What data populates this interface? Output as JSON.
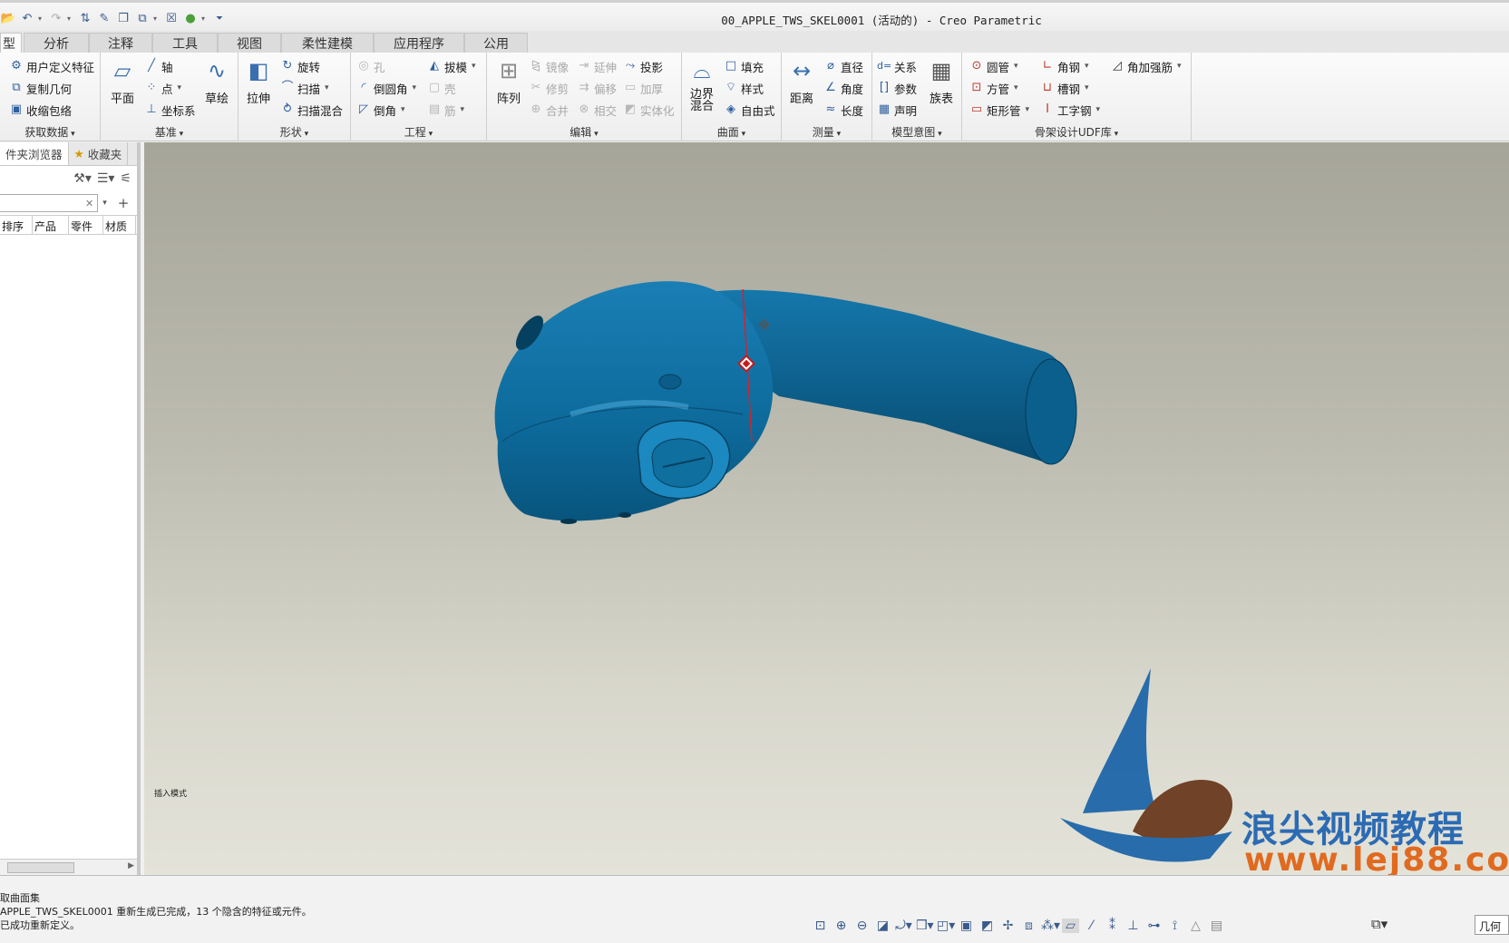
{
  "window": {
    "title": "00_APPLE_TWS_SKEL0001 (活动的) - Creo Parametric"
  },
  "tabs": [
    "型",
    "分析",
    "注释",
    "工具",
    "视图",
    "柔性建模",
    "应用程序",
    "公用"
  ],
  "ribbon": {
    "get_data": {
      "label": "获取数据",
      "items": [
        "用户定义特征",
        "复制几何",
        "收缩包络"
      ]
    },
    "datum": {
      "label": "基准",
      "plane": "平面",
      "axis": "轴",
      "point": "点",
      "csys": "坐标系",
      "sketch": "草绘"
    },
    "shapes": {
      "label": "形状",
      "extrude": "拉伸",
      "revolve": "旋转",
      "sweep": "扫描",
      "swept_blend": "扫描混合"
    },
    "engineering": {
      "label": "工程",
      "hole": "孔",
      "draft": "拔模",
      "round": "倒圆角",
      "shell": "壳",
      "chamfer": "倒角",
      "rib": "筋"
    },
    "editing": {
      "label": "编辑",
      "pattern": "阵列",
      "mirror": "镜像",
      "extend": "延伸",
      "project": "投影",
      "trim": "修剪",
      "offset": "偏移",
      "thicken": "加厚",
      "merge": "合并",
      "intersect": "相交",
      "solidify": "实体化"
    },
    "surfaces": {
      "label": "曲面",
      "boundary_blend_1": "边界",
      "boundary_blend_2": "混合",
      "fill": "填充",
      "style": "样式",
      "freestyle": "自由式"
    },
    "measure": {
      "label": "测量",
      "distance": "距离",
      "diameter": "直径",
      "angle": "角度",
      "length": "长度"
    },
    "model_intent": {
      "label": "模型意图",
      "relations": "关系",
      "parameters": "参数",
      "declare": "声明",
      "family_table": "族表"
    },
    "skeleton_udf": {
      "label": "骨架设计UDF库",
      "round_tube": "圆管",
      "angle_steel": "角钢",
      "gusset": "角加强筋",
      "square_tube": "方管",
      "channel_steel": "槽钢",
      "rect_tube": "矩形管",
      "i_beam": "工字钢"
    }
  },
  "left_panel": {
    "tabs": [
      "件夹浏览器",
      "收藏夹"
    ],
    "filter": {
      "value": "",
      "clear": "✕"
    },
    "columns": [
      "排序",
      "产品",
      "零件",
      "材质"
    ]
  },
  "viewport": {
    "mode_label": "插入模式",
    "watermark_cn": "浪尖视频教程",
    "watermark_url": "www.lej88.co",
    "model_color": "#0d6a9b"
  },
  "messages": [
    "取曲面集",
    "APPLE_TWS_SKEL0001 重新生成已完成，13 个隐含的特征或元件。",
    "已成功重新定义。"
  ],
  "status": {
    "filter_value": "几何"
  }
}
